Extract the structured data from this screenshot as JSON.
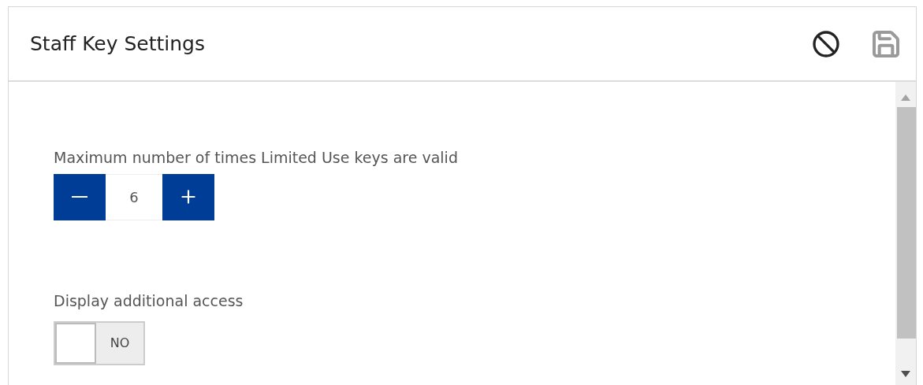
{
  "header": {
    "title": "Staff Key Settings",
    "actions": [
      {
        "kind": "cancel",
        "disabled": false
      },
      {
        "kind": "save",
        "disabled": true
      }
    ]
  },
  "fields": [
    {
      "kind": "stepper",
      "label": "Maximum number of times Limited Use keys are valid",
      "value": "6"
    },
    {
      "kind": "toggle",
      "label": "Display additional access",
      "state_text": "NO",
      "on": false
    }
  ]
}
